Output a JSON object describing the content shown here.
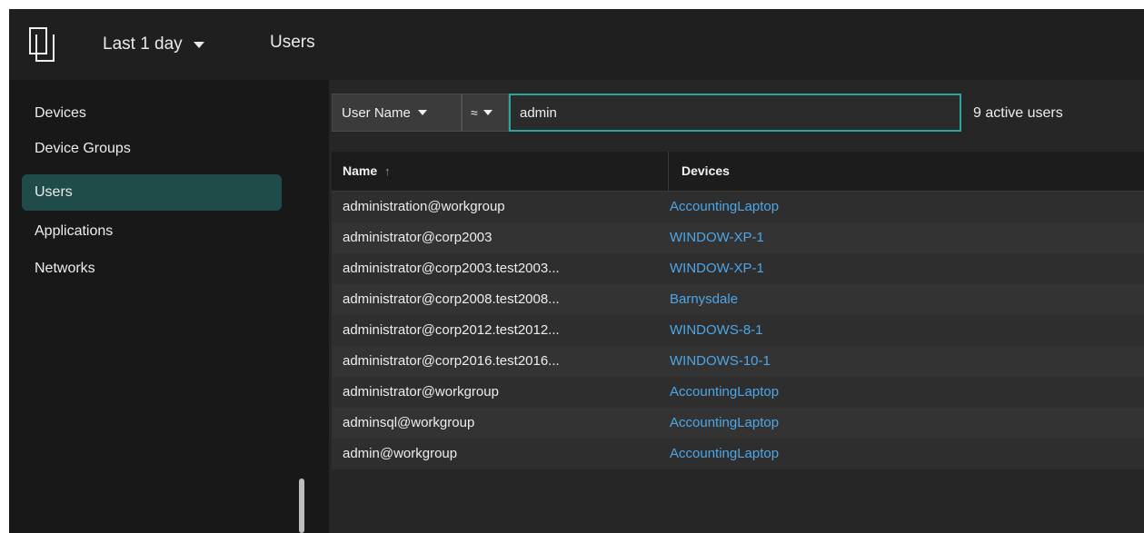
{
  "header": {
    "time_range": "Last 1 day",
    "title": "Users"
  },
  "sidebar": {
    "items": [
      {
        "label": "Devices",
        "active": false
      },
      {
        "label": "Device Groups",
        "active": false
      },
      {
        "label": "Users",
        "active": true
      },
      {
        "label": "Applications",
        "active": false
      },
      {
        "label": "Networks",
        "active": false
      }
    ]
  },
  "filter": {
    "field": "User Name",
    "operator": "≈",
    "value": "admin",
    "result_count": "9 active users"
  },
  "table": {
    "columns": [
      "Name",
      "Devices"
    ],
    "sort_icon": "↑",
    "rows": [
      {
        "name": "administration@workgroup",
        "device": "AccountingLaptop"
      },
      {
        "name": "administrator@corp2003",
        "device": "WINDOW-XP-1"
      },
      {
        "name": "administrator@corp2003.test2003...",
        "device": "WINDOW-XP-1"
      },
      {
        "name": "administrator@corp2008.test2008...",
        "device": "Barnysdale"
      },
      {
        "name": "administrator@corp2012.test2012...",
        "device": "WINDOWS-8-1"
      },
      {
        "name": "administrator@corp2016.test2016...",
        "device": "WINDOWS-10-1"
      },
      {
        "name": "administrator@workgroup",
        "device": "AccountingLaptop"
      },
      {
        "name": "adminsql@workgroup",
        "device": "AccountingLaptop"
      },
      {
        "name": "admin@workgroup",
        "device": "AccountingLaptop"
      }
    ]
  },
  "colors": {
    "accent": "#2aa69a",
    "active_nav": "#1f4b48",
    "link": "#4ea6e6"
  }
}
